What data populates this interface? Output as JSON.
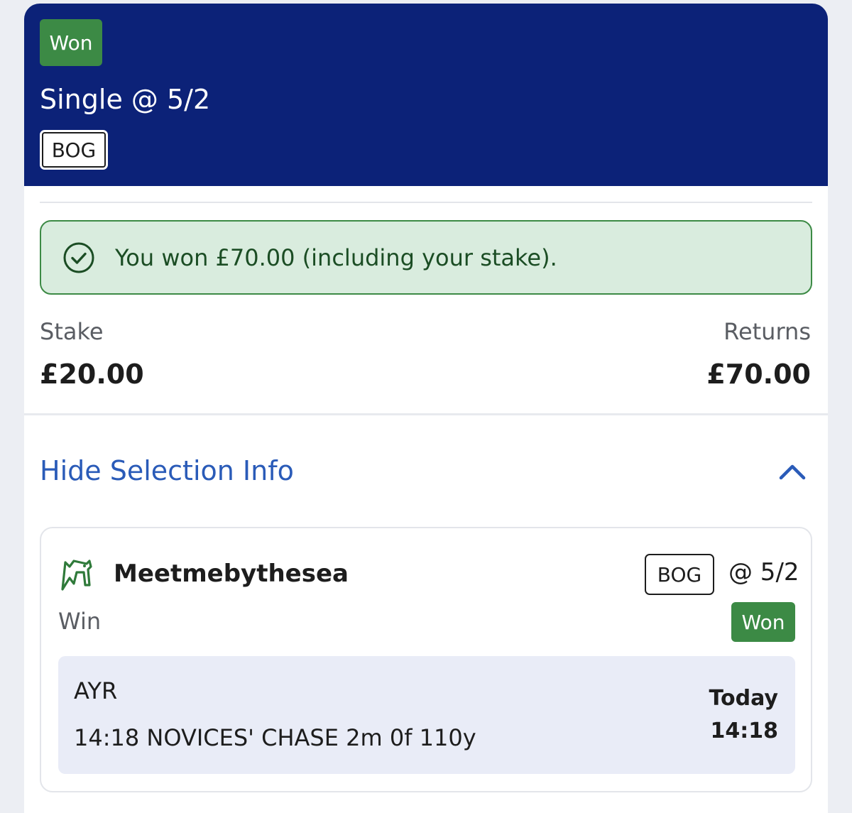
{
  "header": {
    "status_badge": "Won",
    "title": "Single @ 5/2",
    "bog_tag": "BOG",
    "background_color": "#0c2278"
  },
  "result_banner": {
    "icon": "check-circle-icon",
    "text": "You won £70.00 (including your stake).",
    "color": "#3c8a45"
  },
  "summary": {
    "stake_label": "Stake",
    "stake_value": "£20.00",
    "returns_label": "Returns",
    "returns_value": "£70.00"
  },
  "selection_toggle": {
    "label": "Hide Selection Info",
    "icon": "chevron-up-icon",
    "color": "#2a5bb8"
  },
  "selection": {
    "icon": "horse-racing-icon",
    "runner": "Meetmebythesea",
    "market": "Win",
    "bog_tag": "BOG",
    "odds": "@ 5/2",
    "status_badge": "Won",
    "event": {
      "course": "AYR",
      "race": "14:18 NOVICES' CHASE 2m 0f 110y",
      "date": "Today",
      "time": "14:18"
    }
  }
}
